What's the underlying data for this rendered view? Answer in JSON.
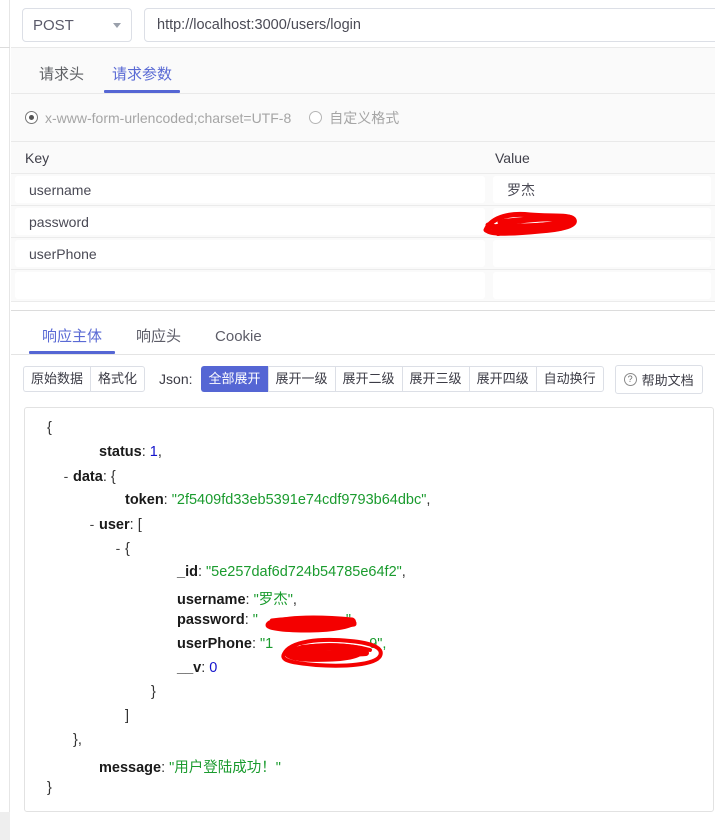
{
  "request": {
    "method": "POST",
    "method_caret": "chevron-down-icon",
    "url": "http://localhost:3000/users/login",
    "url_placeholder": "http://localhost:3000/users/login",
    "tabs": [
      {
        "label": "请求头",
        "active": false
      },
      {
        "label": "请求参数",
        "active": true
      }
    ],
    "content_types": [
      {
        "label": "x-www-form-urlencoded;charset=UTF-8",
        "selected": true
      },
      {
        "label": "自定义格式",
        "selected": false
      }
    ],
    "params_table": {
      "columns": [
        "Key",
        "Value"
      ],
      "rows": [
        {
          "key": "username",
          "value": "罗杰",
          "redacted": false
        },
        {
          "key": "password",
          "value": "",
          "redacted": true
        },
        {
          "key": "userPhone",
          "value": "",
          "redacted": false
        },
        {
          "key": "",
          "value": "",
          "redacted": false
        }
      ]
    }
  },
  "response": {
    "tabs": [
      {
        "label": "响应主体",
        "active": true
      },
      {
        "label": "响应头",
        "active": false
      },
      {
        "label": "Cookie",
        "active": false
      }
    ],
    "toolbar": {
      "format_group": [
        "原始数据",
        "格式化"
      ],
      "json_label": "Json:",
      "expand_group": [
        {
          "label": "全部展开",
          "active": true
        },
        {
          "label": "展开一级",
          "active": false
        },
        {
          "label": "展开二级",
          "active": false
        },
        {
          "label": "展开三级",
          "active": false
        },
        {
          "label": "展开四级",
          "active": false
        },
        {
          "label": "自动换行",
          "active": false
        }
      ],
      "help_icon": "question-circle-icon",
      "help_label": "帮助文档"
    },
    "body_lines": [
      {
        "indent": 0,
        "toggle": "",
        "text": "{",
        "type": "brace"
      },
      {
        "indent": 2,
        "toggle": "",
        "key": "status",
        "value": "1",
        "vtype": "num",
        "suffix": ","
      },
      {
        "indent": 1,
        "toggle": "-",
        "key": "data",
        "value": "{",
        "vtype": "brace",
        "suffix": ""
      },
      {
        "indent": 3,
        "toggle": "",
        "key": "token",
        "value": "\"2f5409fd33eb5391e74cdf9793b64dbc\"",
        "vtype": "str",
        "suffix": ","
      },
      {
        "indent": 2,
        "toggle": "-",
        "key": "user",
        "value": "[",
        "vtype": "brace",
        "suffix": ""
      },
      {
        "indent": 3,
        "toggle": "-",
        "key": "",
        "value": "{",
        "vtype": "brace",
        "suffix": ""
      },
      {
        "indent": 5,
        "toggle": "",
        "key": "_id",
        "value": "\"5e257daf6d724b54785e64f2\"",
        "vtype": "str",
        "suffix": ","
      },
      {
        "indent": 5,
        "toggle": "",
        "key": "username",
        "value": "\"罗杰\"",
        "vtype": "str",
        "suffix": ","
      },
      {
        "indent": 5,
        "toggle": "",
        "key": "password",
        "value": "\"",
        "vtype": "str",
        "suffix": "\",",
        "redacted": true
      },
      {
        "indent": 5,
        "toggle": "",
        "key": "userPhone",
        "value": "\"1",
        "vtype": "str",
        "suffix": "9\",",
        "redacted": true
      },
      {
        "indent": 5,
        "toggle": "",
        "key": "__v",
        "value": "0",
        "vtype": "num",
        "suffix": ""
      },
      {
        "indent": 4,
        "toggle": "",
        "text": "}",
        "type": "brace"
      },
      {
        "indent": 3,
        "toggle": "",
        "text": "]",
        "type": "brace"
      },
      {
        "indent": 1,
        "toggle": "",
        "text": "},",
        "type": "brace"
      },
      {
        "indent": 2,
        "toggle": "",
        "key": "message",
        "value": "\"用户登陆成功！\"",
        "vtype": "str",
        "suffix": ""
      },
      {
        "indent": 0,
        "toggle": "",
        "text": "}",
        "type": "brace"
      }
    ]
  },
  "colors": {
    "accent": "#5566d4",
    "redaction": "#f40000",
    "string": "#1a9b2e",
    "number": "#1414cc",
    "panel_bg": "#fafafa"
  }
}
